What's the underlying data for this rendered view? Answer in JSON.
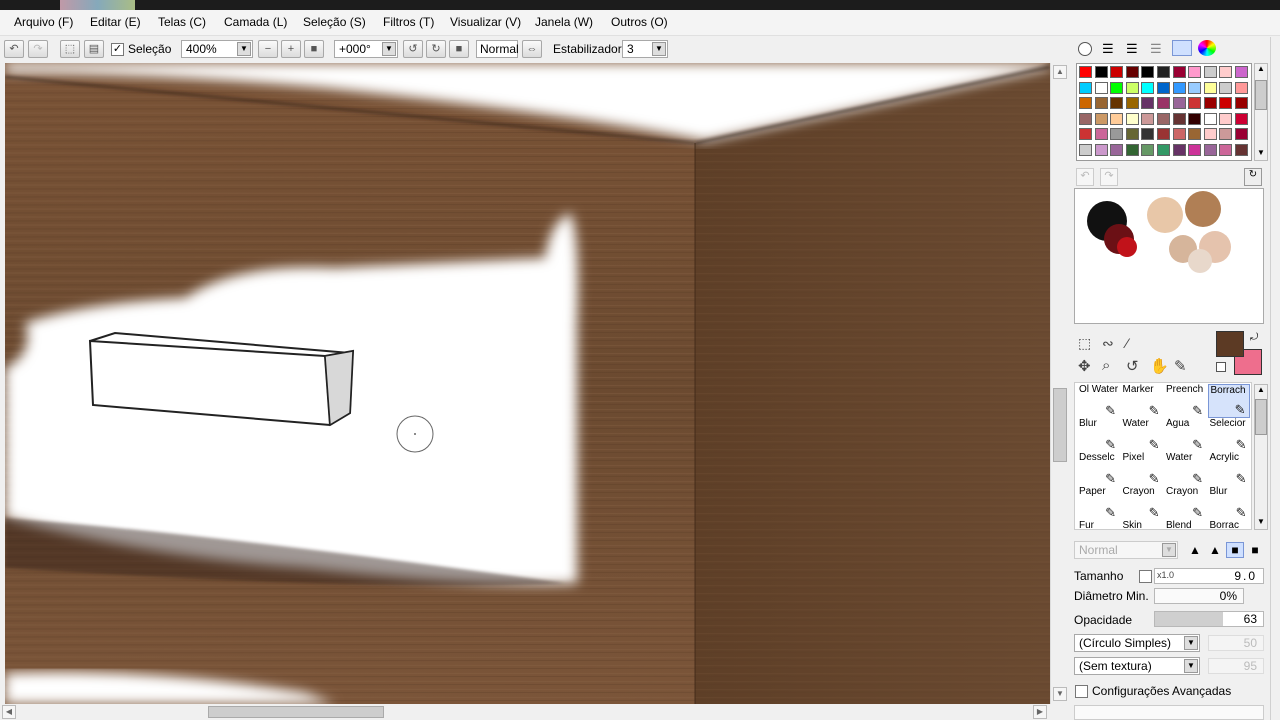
{
  "menu": [
    "Arquivo (F)",
    "Editar (E)",
    "Telas (C)",
    "Camada (L)",
    "Seleção (S)",
    "Filtros (T)",
    "Visualizar (V)",
    "Janela (W)",
    "Outros (O)"
  ],
  "toolbar": {
    "selection_label": "Seleção",
    "zoom": "400%",
    "rotation": "+000°",
    "blend_mode": "Normal",
    "stabilizer_label": "Estabilizador",
    "stabilizer_value": "3"
  },
  "palette_colors": [
    "#ff0000",
    "#000000",
    "#cc0000",
    "#660000",
    "#000000",
    "#222222",
    "#990033",
    "#ff99cc",
    "#cccccc",
    "#ffcccc",
    "#cc66cc",
    "#00ccff",
    "#ffffff",
    "#00ff00",
    "#ccff66",
    "#00ffff",
    "#0066cc",
    "#3399ff",
    "#99ccff",
    "#ffff99",
    "#cccccc",
    "#ff9999",
    "#cc6600",
    "#996633",
    "#663300",
    "#996600",
    "#663366",
    "#993366",
    "#996699",
    "#cc3333",
    "#990000",
    "#cc0000",
    "#990000",
    "#996666",
    "#cc9966",
    "#ffcc99",
    "#ffffcc",
    "#cc9999",
    "#996666",
    "#663333",
    "#330000",
    "#ffffff",
    "#ffcccc",
    "#cc0033",
    "#cc3333",
    "#cc6699",
    "#999999",
    "#666633",
    "#333333",
    "#993333",
    "#cc6666",
    "#996633",
    "#ffcccc",
    "#cc9999",
    "#990033",
    "#cccccc",
    "#cc99cc",
    "#996699",
    "#336633",
    "#669966",
    "#339966",
    "#663366",
    "#cc3399",
    "#996699",
    "#cc6699",
    "#663333"
  ],
  "colors": {
    "main": "#5c3a24",
    "secondary": "#ee6e8d"
  },
  "tools": [
    {
      "label": "Ol Water",
      "selected": false
    },
    {
      "label": "Marker",
      "selected": false
    },
    {
      "label": "Preench",
      "selected": false
    },
    {
      "label": "Borrach",
      "selected": true
    },
    {
      "label": "Blur",
      "selected": false
    },
    {
      "label": "Water",
      "selected": false
    },
    {
      "label": "Água",
      "selected": false
    },
    {
      "label": "Selecior",
      "selected": false
    },
    {
      "label": "Desselc",
      "selected": false
    },
    {
      "label": "Pixel",
      "selected": false
    },
    {
      "label": "Water",
      "selected": false
    },
    {
      "label": "Acrylic",
      "selected": false
    },
    {
      "label": "Paper",
      "selected": false
    },
    {
      "label": "Crayon",
      "selected": false
    },
    {
      "label": "Crayon",
      "selected": false
    },
    {
      "label": "Blur",
      "selected": false
    },
    {
      "label": "Fur",
      "selected": false
    },
    {
      "label": "Skin",
      "selected": false
    },
    {
      "label": "Blend",
      "selected": false
    },
    {
      "label": "Borrac",
      "selected": false
    }
  ],
  "brush": {
    "mode": "Normal",
    "size_label": "Tamanho",
    "size_multiplier": "x1.0",
    "size_value": "9.0",
    "min_diameter_label": "Diâmetro Min.",
    "min_diameter_value": "0%",
    "opacity_label": "Opacidade",
    "opacity_value": "63",
    "opacity_level": 0.63,
    "shape": "(Círculo Simples)",
    "shape_value": "50",
    "texture": "(Sem textura)",
    "texture_value": "95",
    "advanced_label": "Configurações Avançadas"
  }
}
